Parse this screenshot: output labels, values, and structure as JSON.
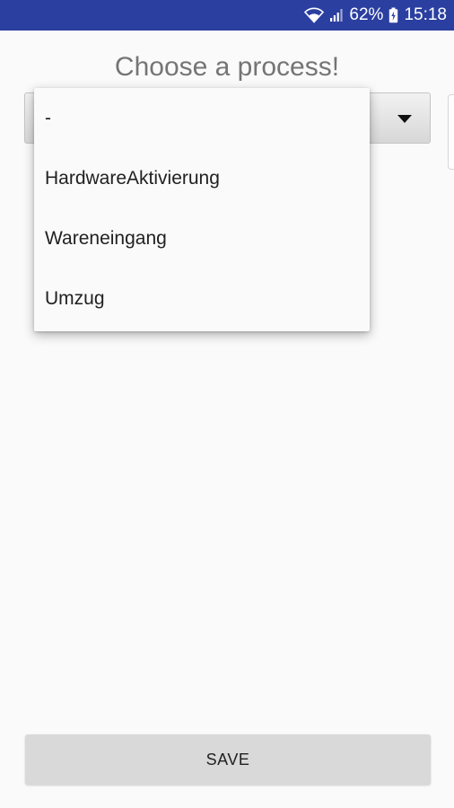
{
  "status_bar": {
    "battery_percent": "62%",
    "time": "15:18",
    "icons": [
      "wifi-icon",
      "signal-icon",
      "battery-icon"
    ],
    "background_color": "#2b3fa0"
  },
  "screen": {
    "title": "Choose a process!"
  },
  "process_spinner": {
    "options": [
      "-",
      "HardwareAktivierung",
      "Wareneingang",
      "Umzug"
    ],
    "expanded": true
  },
  "actions": {
    "save_label": "SAVE"
  }
}
